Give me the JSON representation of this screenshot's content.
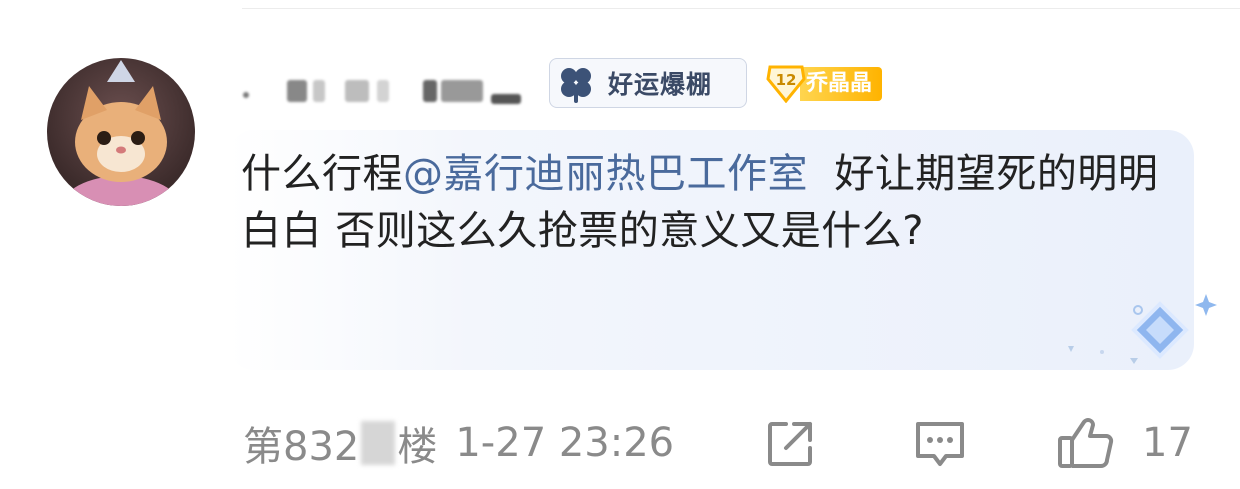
{
  "comment": {
    "username": "username-hidden",
    "fan_badge_label": "好运爆棚",
    "level": "12",
    "level_name": "乔晶晶",
    "text_before": "什么行程",
    "mention": "@嘉行迪丽热巴工作室",
    "text_after": "  好让期望死的明明白白 否则这么久抢票的意义又是什么?",
    "floor_prefix": "第832",
    "floor_suffix": "楼",
    "timestamp": "1-27 23:26",
    "like_count": "17"
  },
  "icons": [
    "avatar",
    "clover-icon",
    "level-shield-icon",
    "diamond-decoration",
    "share-icon",
    "reply-icon",
    "like-icon"
  ],
  "colors": {
    "mention": "#4a6a9c",
    "meta_gray": "#8a8a8a",
    "level_gold": "#ffb300",
    "bubble_blue": "#eaf0fb"
  }
}
